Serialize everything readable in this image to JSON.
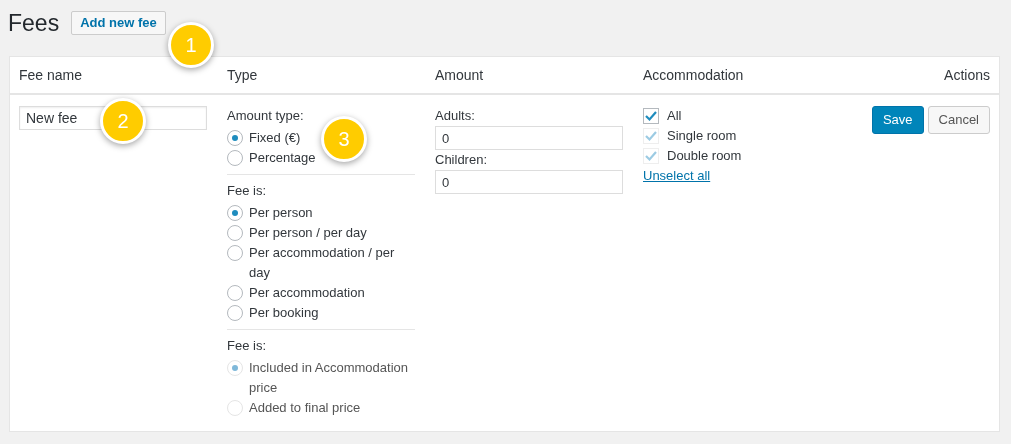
{
  "page_title": "Fees",
  "add_button": "Add new fee",
  "callouts": [
    {
      "number": "1"
    },
    {
      "number": "2"
    },
    {
      "number": "3"
    }
  ],
  "table": {
    "columns": [
      "Fee name",
      "Type",
      "Amount",
      "Accommodation",
      "Actions"
    ],
    "row": {
      "fee_name": "New fee",
      "type_groups": [
        {
          "label": "Amount type:",
          "options": [
            {
              "label": "Fixed (€)",
              "selected": true,
              "disabled": false
            },
            {
              "label": "Percentage",
              "selected": false,
              "disabled": false
            }
          ]
        },
        {
          "label": "Fee is:",
          "options": [
            {
              "label": "Per person",
              "selected": true,
              "disabled": false
            },
            {
              "label": "Per person / per day",
              "selected": false,
              "disabled": false
            },
            {
              "label": "Per accommodation / per day",
              "selected": false,
              "disabled": false
            },
            {
              "label": "Per accommodation",
              "selected": false,
              "disabled": false
            },
            {
              "label": "Per booking",
              "selected": false,
              "disabled": false
            }
          ]
        },
        {
          "label": "Fee is:",
          "options": [
            {
              "label": "Included in Accommodation price",
              "selected": true,
              "disabled": true
            },
            {
              "label": "Added to final price",
              "selected": false,
              "disabled": true
            }
          ]
        }
      ],
      "amounts": [
        {
          "label": "Adults:",
          "value": "0"
        },
        {
          "label": "Children:",
          "value": "0"
        }
      ],
      "accommodations": [
        {
          "label": "All",
          "checked": true,
          "disabled": false
        },
        {
          "label": "Single room",
          "checked": true,
          "disabled": true
        },
        {
          "label": "Double room",
          "checked": true,
          "disabled": true
        }
      ],
      "unselect_link": "Unselect all",
      "actions": [
        {
          "label": "Save",
          "kind": "primary"
        },
        {
          "label": "Cancel",
          "kind": "secondary"
        }
      ]
    }
  }
}
